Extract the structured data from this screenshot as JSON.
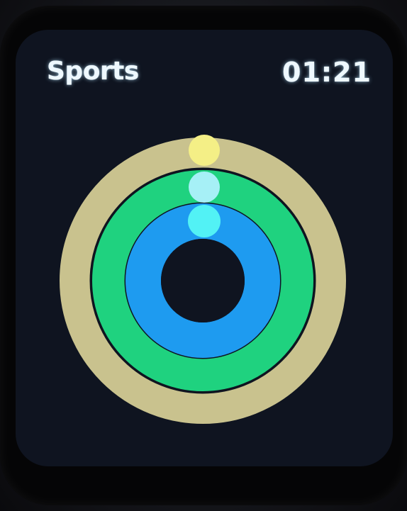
{
  "app": {
    "title": "Sports",
    "time": "01:21"
  },
  "activity_rings": [
    {
      "name": "outer-ring",
      "color": "#c9c28e",
      "dot_color": "#f4ef86"
    },
    {
      "name": "middle-ring",
      "color": "#1fd27f",
      "dot_color": "#a6f0f6"
    },
    {
      "name": "inner-ring",
      "color": "#1e9bf0",
      "dot_color": "#52f2f5"
    }
  ],
  "colors": {
    "screen_background": "#0f1420",
    "text": "#eef8ff"
  }
}
